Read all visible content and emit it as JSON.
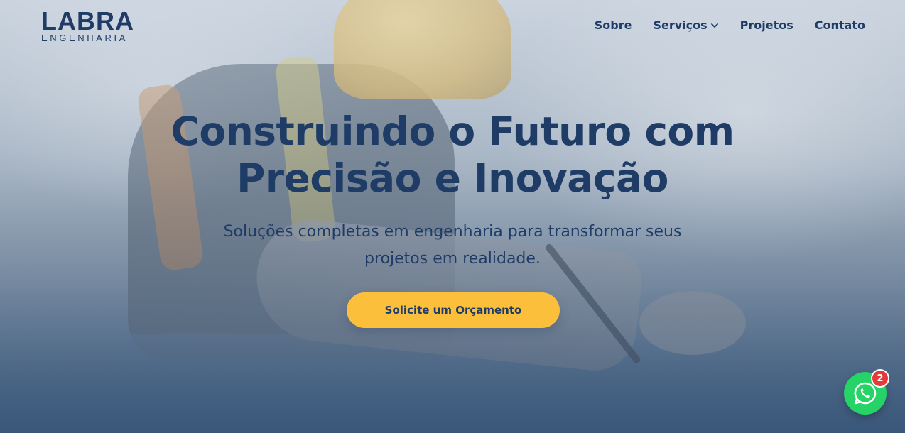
{
  "brand": {
    "logo_main": "LABRA",
    "logo_sub": "ENGENHARIA",
    "primary_color": "#1e3c66",
    "accent_color": "#fbbf3c"
  },
  "nav": {
    "items": [
      {
        "label": "Sobre"
      },
      {
        "label": "Serviços",
        "has_dropdown": true
      },
      {
        "label": "Projetos"
      },
      {
        "label": "Contato"
      }
    ]
  },
  "hero": {
    "title_line1": "Construindo o Futuro com",
    "title_line2": "Precisão e Inovação",
    "subtitle_line1": "Soluções completas em engenharia para transformar seus",
    "subtitle_line2": "projetos em realidade.",
    "cta_label": "Solicite um Orçamento"
  },
  "whatsapp": {
    "icon": "whatsapp-icon",
    "badge_count": "2",
    "color": "#25d366"
  }
}
